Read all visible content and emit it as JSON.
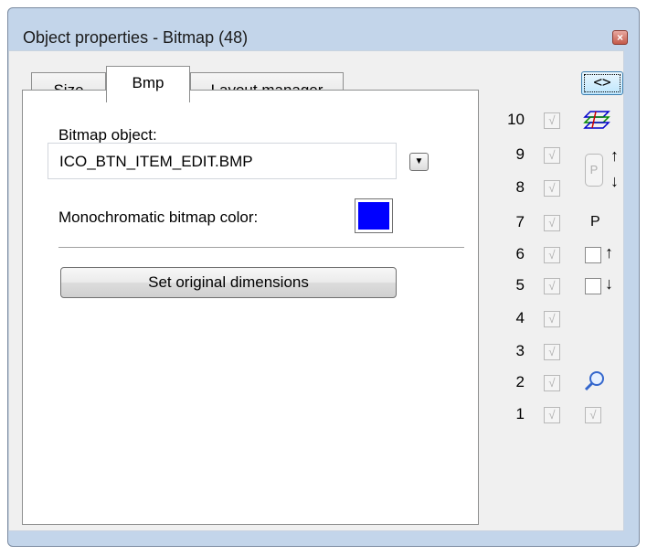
{
  "window": {
    "title": "Object properties - Bitmap (48)",
    "close_glyph": "×"
  },
  "tabs": [
    {
      "label": "Size",
      "active": false
    },
    {
      "label": "Bmp",
      "active": true
    },
    {
      "label": "Layout manager",
      "active": false
    }
  ],
  "bmp": {
    "bitmap_object_label": "Bitmap object:",
    "bitmap_object_value": "ICO_BTN_ITEM_EDIT.BMP",
    "mono_color_label": "Monochromatic bitmap color:",
    "mono_color": "#0000ff",
    "set_original_label": "Set original dimensions"
  },
  "side": {
    "swap_label": "<>",
    "layers": [
      {
        "num": "10",
        "checked": true
      },
      {
        "num": "9",
        "checked": true
      },
      {
        "num": "8",
        "checked": true
      },
      {
        "num": "7",
        "checked": true
      },
      {
        "num": "6",
        "checked": true
      },
      {
        "num": "5",
        "checked": true
      },
      {
        "num": "4",
        "checked": true
      },
      {
        "num": "3",
        "checked": true
      },
      {
        "num": "2",
        "checked": true
      },
      {
        "num": "1",
        "checked": true
      }
    ],
    "p_button_label": "P",
    "p_label": "P",
    "up_arrow": "↑",
    "down_arrow": "↓",
    "check_glyph": "√",
    "icons": [
      "layers-icon",
      "magnifier-icon"
    ]
  }
}
